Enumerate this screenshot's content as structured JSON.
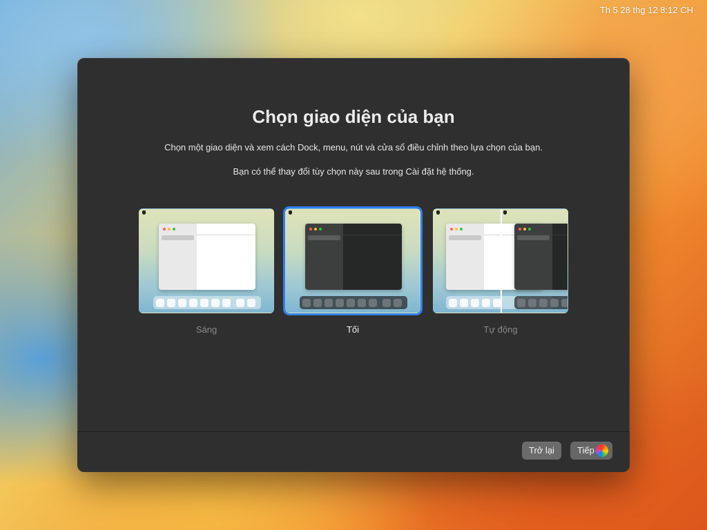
{
  "menubar": {
    "clock": "Th 5 28 thg 12  8:12 CH"
  },
  "dialog": {
    "title": "Chọn giao diện của bạn",
    "description_1": "Chọn một giao diện và xem cách Dock, menu, nút và cửa sổ điều chỉnh theo lựa chọn của bạn.",
    "description_2": "Bạn có thể thay đổi tùy chọn này sau trong Cài đặt hệ thống.",
    "options": [
      {
        "label": "Sáng",
        "selected": false
      },
      {
        "label": "Tối",
        "selected": true
      },
      {
        "label": "Tự động",
        "selected": false
      }
    ],
    "buttons": {
      "back": "Trở lại",
      "next": "Tiếp"
    }
  },
  "colors": {
    "window_bg": "#2f2f2f",
    "selection_accent": "#2f80ed",
    "button_bg": "#6b6b6b"
  }
}
